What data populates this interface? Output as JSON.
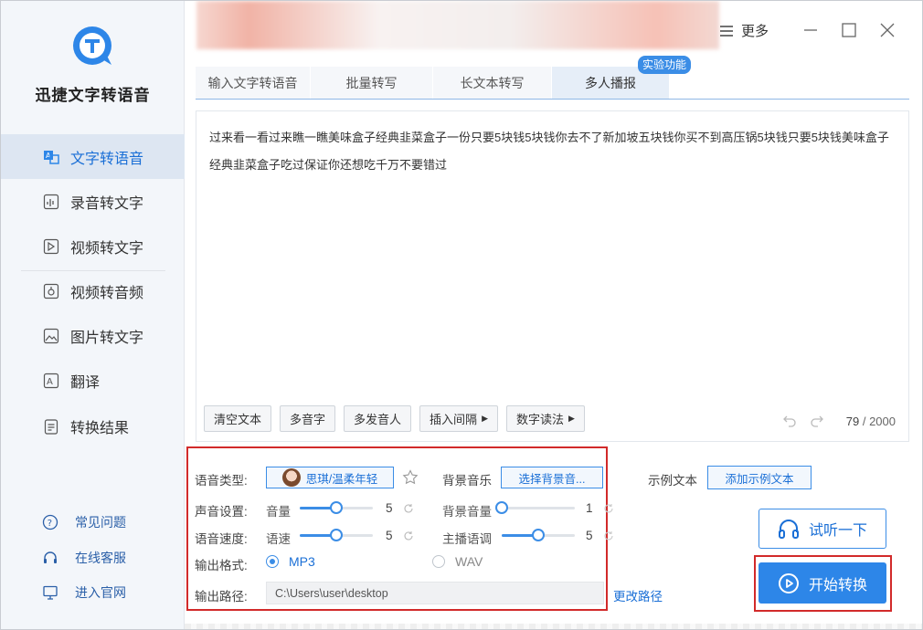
{
  "app": {
    "title": "迅捷文字转语音",
    "accent": "#2d86e8",
    "highlight": "#d22a2a"
  },
  "sidebar": {
    "items": [
      {
        "label": "文字转语音",
        "icon": "text-to-speech-icon",
        "active": true
      },
      {
        "label": "录音转文字",
        "icon": "audio-to-text-icon"
      },
      {
        "label": "视频转文字",
        "icon": "video-to-text-icon"
      },
      {
        "label": "视频转音频",
        "icon": "video-to-audio-icon"
      },
      {
        "label": "图片转文字",
        "icon": "image-to-text-icon"
      },
      {
        "label": "翻译",
        "icon": "translate-icon"
      },
      {
        "label": "转换结果",
        "icon": "results-icon"
      }
    ],
    "links": [
      {
        "label": "常见问题",
        "icon": "question-icon"
      },
      {
        "label": "在线客服",
        "icon": "headset-icon"
      },
      {
        "label": "进入官网",
        "icon": "monitor-icon"
      }
    ]
  },
  "header": {
    "more_label": "更多"
  },
  "tabs": {
    "items": [
      "输入文字转语音",
      "批量转写",
      "长文本转写",
      "多人播报"
    ],
    "active_index": 3,
    "badge": "实验功能"
  },
  "editor": {
    "text": "过来看一看过来瞧一瞧美味盒子经典韭菜盒子一份只要5块钱5块钱你去不了新加坡五块钱你买不到高压锅5块钱只要5块钱美味盒子经典韭菜盒子吃过保证你还想吃千万不要错过",
    "tools": [
      "清空文本",
      "多音字",
      "多发音人",
      "插入间隔",
      "数字读法"
    ],
    "count_current": "79",
    "count_max": " / 2000"
  },
  "settings": {
    "voice_type_label": "语音类型:",
    "voice_name": "思琪/温柔年轻",
    "bg_music_label": "背景音乐",
    "bg_music_button": "选择背景音...",
    "sample_text_label": "示例文本",
    "sample_text_button": "添加示例文本",
    "sound_label": "声音设置:",
    "volume_label": "音量",
    "volume_value": "5",
    "volume_level": 0.5,
    "bg_volume_label": "背景音量",
    "bg_volume_value": "1",
    "bg_volume_level": 0.0,
    "speed_label": "语音速度:",
    "rate_label": "语速",
    "rate_value": "5",
    "rate_level": 0.5,
    "pitch_label": "主播语调",
    "pitch_value": "5",
    "pitch_level": 0.5,
    "format_label": "输出格式:",
    "format_mp3": "MP3",
    "format_wav": "WAV",
    "format_selected": "MP3",
    "path_label": "输出路径:",
    "path_value": "C:\\Users\\user\\desktop",
    "change_path": "更改路径"
  },
  "actions": {
    "listen": "试听一下",
    "start": "开始转换"
  }
}
